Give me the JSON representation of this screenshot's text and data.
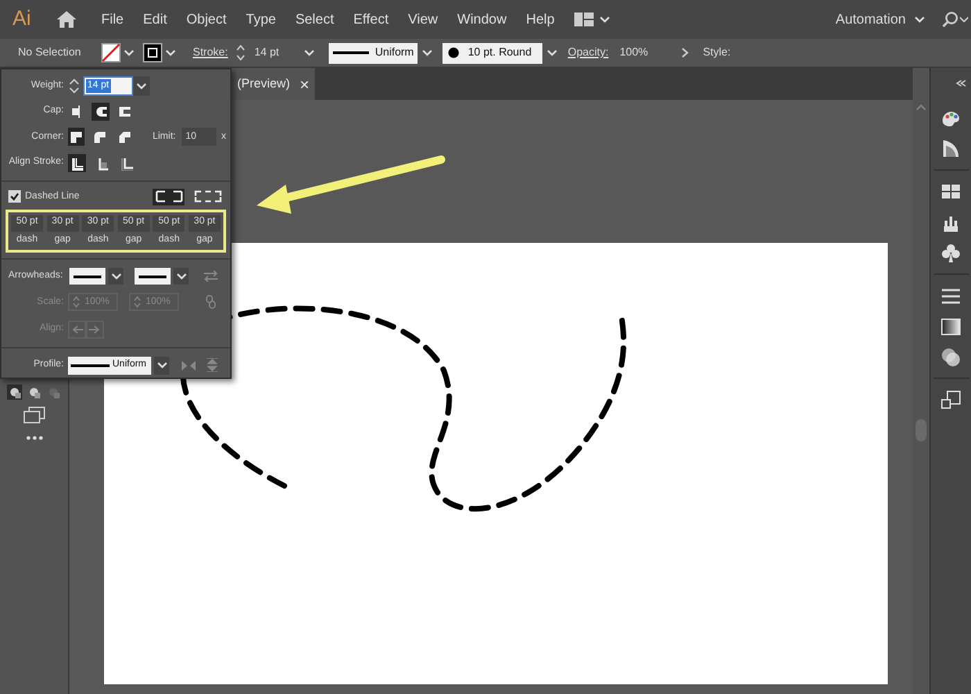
{
  "menu_bar": {
    "logo": "Ai",
    "items": [
      "File",
      "Edit",
      "Object",
      "Type",
      "Select",
      "Effect",
      "View",
      "Window",
      "Help"
    ],
    "workspace": "Automation"
  },
  "control_bar": {
    "selection": "No Selection",
    "stroke_label": "Stroke:",
    "stroke_weight": "14 pt",
    "profile": "Uniform",
    "brush": "10 pt. Round",
    "opacity_label": "Opacity:",
    "opacity": "100%",
    "style_label": "Style:"
  },
  "document_tab": {
    "title": "(Preview)",
    "close": "×"
  },
  "stroke_panel": {
    "weight": {
      "label": "Weight:",
      "value": "14 pt"
    },
    "cap": {
      "label": "Cap:",
      "options": [
        {
          "selected": false
        },
        {
          "selected": true
        },
        {
          "selected": false
        }
      ]
    },
    "corner": {
      "label": "Corner:",
      "options": [
        {
          "selected": true
        },
        {
          "selected": false
        },
        {
          "selected": false
        }
      ],
      "limit_label": "Limit:",
      "limit": "10",
      "limit_unit": "x"
    },
    "align_stroke": {
      "label": "Align Stroke:",
      "options": [
        {
          "selected": true
        },
        {
          "selected": false
        },
        {
          "selected": false
        }
      ]
    },
    "dashed_line": {
      "label": "Dashed Line",
      "checked": true,
      "modes": [
        {
          "selected": true
        },
        {
          "selected": false
        }
      ]
    },
    "dash_fields": [
      {
        "value": "50 pt",
        "label": "dash"
      },
      {
        "value": "30 pt",
        "label": "gap"
      },
      {
        "value": "30 pt",
        "label": "dash"
      },
      {
        "value": "50 pt",
        "label": "gap"
      },
      {
        "value": "50 pt",
        "label": "dash"
      },
      {
        "value": "30 pt",
        "label": "gap"
      }
    ],
    "arrowheads": {
      "label": "Arrowheads:"
    },
    "scale": {
      "label": "Scale:",
      "start": "100%",
      "end": "100%",
      "disabled": true
    },
    "align": {
      "label": "Align:",
      "disabled": true
    },
    "profile": {
      "label": "Profile:",
      "value": "Uniform"
    }
  }
}
